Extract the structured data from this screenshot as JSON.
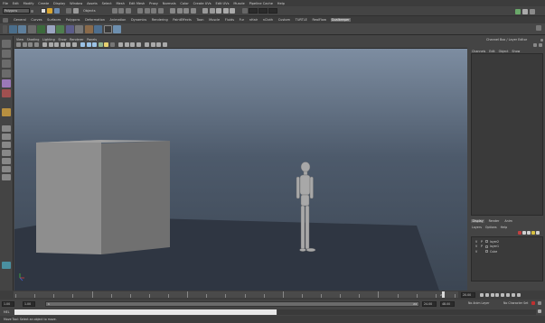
{
  "menubar": {
    "items": [
      "File",
      "Edit",
      "Modify",
      "Create",
      "Display",
      "Window",
      "Assets",
      "Select",
      "Mesh",
      "Edit Mesh",
      "Proxy",
      "Normals",
      "Color",
      "Create UVs",
      "Edit UVs",
      "Muscle",
      "Pipeline Cache",
      "Help"
    ]
  },
  "statusline": {
    "mode": "Polygons",
    "objects_label": "Objects"
  },
  "shelf": {
    "tabs": [
      "General",
      "Curves",
      "Surfaces",
      "Polygons",
      "Deformation",
      "Animation",
      "Dynamics",
      "Rendering",
      "PaintEffects",
      "Toon",
      "Muscle",
      "Fluids",
      "Fur",
      "nHair",
      "nCloth",
      "Custom",
      "TURTLE",
      "RealFlow",
      "Goalkeeper"
    ],
    "active_tab": "Goalkeeper"
  },
  "panel": {
    "menus": [
      "View",
      "Shading",
      "Lighting",
      "Show",
      "Renderer",
      "Panels"
    ]
  },
  "channel_box": {
    "title": "Channel Box / Layer Editor",
    "menus": [
      "Channels",
      "Edit",
      "Object",
      "Show"
    ]
  },
  "layer_editor": {
    "tabs": [
      "Display",
      "Render",
      "Anim"
    ],
    "menus": [
      "Layers",
      "Options",
      "Help"
    ],
    "layers": [
      {
        "v": "V",
        "p": "P",
        "name": "layer2"
      },
      {
        "v": "V",
        "p": "P",
        "name": "layer1"
      },
      {
        "v": "V",
        "p": "",
        "name": "Cube"
      }
    ]
  },
  "timeline": {
    "current_frame": "20.00",
    "marker_frame": "20",
    "ticks": [
      "1",
      "2",
      "3",
      "4",
      "5",
      "6",
      "7",
      "8",
      "9",
      "10",
      "11",
      "12",
      "13",
      "14",
      "15",
      "16",
      "17",
      "18",
      "19",
      "20",
      "21",
      "22",
      "23",
      "24"
    ]
  },
  "range": {
    "start": "1.00",
    "anim_start": "1.00",
    "range_start_box": "1",
    "range_end_box": "24",
    "end": "24.00",
    "anim_end": "48.00",
    "anim_layer": "No Anim Layer",
    "char_set": "No Character Set"
  },
  "command_line": {
    "label": "MEL"
  },
  "help_line": {
    "text": "Move Tool: Select an object to move."
  },
  "colors": {
    "accent": "#76a0c8",
    "current_frame_marker": "#d8d8d8",
    "red_key": "#c03030",
    "cube": "#8e8e8e"
  }
}
